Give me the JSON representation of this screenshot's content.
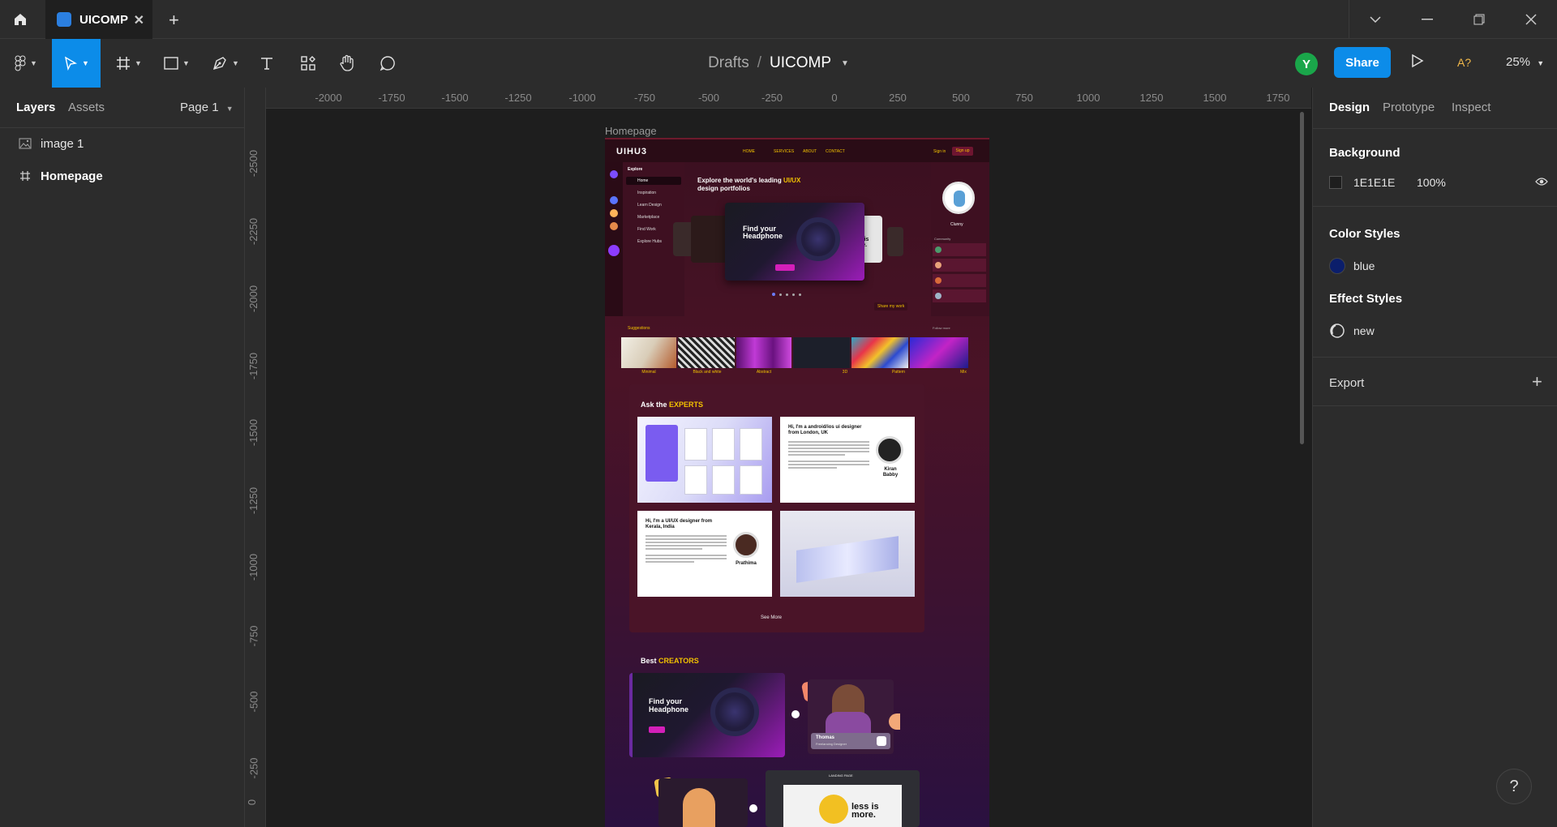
{
  "titlebar": {
    "tab_title": "UICOMP",
    "icons": [
      "home-icon",
      "figma-file-icon",
      "close-icon",
      "plus-icon",
      "chevron-down-icon",
      "minimize-icon",
      "restore-icon",
      "close-window-icon"
    ]
  },
  "toolbar": {
    "tools": [
      "main-menu",
      "move",
      "frame",
      "shape",
      "pen",
      "text",
      "resources",
      "hand",
      "comment"
    ],
    "active_tool": "move",
    "breadcrumb_folder": "Drafts",
    "breadcrumb_sep": "/",
    "breadcrumb_file": "UICOMP",
    "avatar_initial": "Y",
    "share_label": "Share",
    "font_check_label": "A?",
    "zoom": "25%"
  },
  "left_panel": {
    "tab_layers": "Layers",
    "tab_assets": "Assets",
    "page": "Page 1",
    "layers": [
      {
        "name": "image 1",
        "icon": "image-icon"
      },
      {
        "name": "Homepage",
        "icon": "frame-hash-icon"
      }
    ]
  },
  "rulers": {
    "top": [
      "-2000",
      "-1750",
      "-1500",
      "-1250",
      "-1000",
      "-750",
      "-500",
      "-250",
      "0",
      "250",
      "500",
      "750",
      "1000",
      "1250",
      "1500",
      "1750"
    ],
    "left": [
      "-2500",
      "-2250",
      "-2000",
      "-1750",
      "-1500",
      "-1250",
      "-1000",
      "-750",
      "-500",
      "-250",
      "0"
    ]
  },
  "canvas": {
    "frame_label": "Homepage",
    "artboard": {
      "logo": "UIHU3",
      "nav_links": [
        "HOME",
        "SERVICES",
        "ABOUT",
        "CONTACT"
      ],
      "sign_in": "Sign in",
      "sign_up": "Sign up",
      "sidebar_title": "Explore",
      "sidebar_items": [
        "Home",
        "Inspiration",
        "Learn Design",
        "Marketplace",
        "Find Work",
        "Explore Hubs"
      ],
      "hero_title_1": "Explore the world's leading",
      "hero_title_hl": "UI/UX",
      "hero_title_2": "design portfolios",
      "hero_card_title": "Find your Headphone",
      "hero_side_text": "less is more.",
      "share_work": "Share my work",
      "profile_name": "Clunny",
      "community_title": "Community",
      "suggestions_title": "Suggestions",
      "follow_more": "Follow more",
      "categories": [
        "Minimal",
        "Black and white",
        "Abstract",
        "3D",
        "Pattern",
        "Mix"
      ],
      "experts_title": "Ask the",
      "experts_hl": "EXPERTS",
      "expert_1_intro": "Hi, I'm a android/ios ui designer from London, UK",
      "expert_1_name": "Kiran Babby",
      "expert_2_intro": "Hi, I'm a UI/UX designer from Kerala, India",
      "expert_2_name": "Prathima",
      "see_more": "See More",
      "creators_title": "Best",
      "creators_hl": "CREATORS",
      "creator_card_title": "Find your Headphone",
      "creator_name": "Thomas",
      "creator_role": "Freelancing Designer",
      "landing_label": "LANDING PAGE",
      "landing_text": "less is more."
    }
  },
  "right_panel": {
    "tab_design": "Design",
    "tab_prototype": "Prototype",
    "tab_inspect": "Inspect",
    "background_title": "Background",
    "background_hex": "1E1E1E",
    "background_opacity": "100%",
    "color_styles_title": "Color Styles",
    "color_style_name": "blue",
    "effect_styles_title": "Effect Styles",
    "effect_style_name": "new",
    "export_title": "Export",
    "help": "?"
  },
  "colors": {
    "accent": "#0c8ce9",
    "panel": "#2c2c2c",
    "canvas": "#1e1e1e",
    "avatar": "#1aa64a",
    "blue_style": "#0b1e6b",
    "artboard_highlight": "#f2c200"
  }
}
